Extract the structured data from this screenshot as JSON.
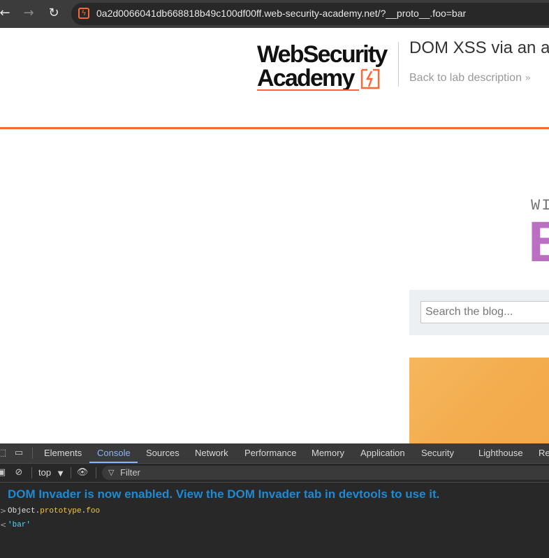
{
  "browser": {
    "back_icon": "arrow-left-icon",
    "forward_icon": "arrow-right-icon",
    "reload_icon": "reload-icon",
    "url": "0a2d0066041db668818b49c100df00ff.web-security-academy.net/?__proto__.foo=bar"
  },
  "page": {
    "logo_line1": "WebSecurity",
    "logo_line2": "Academy",
    "lab_title": "DOM XSS via an a",
    "back_link": "Back to lab description",
    "back_chevron": "»",
    "hero_small": "WI",
    "hero_big": "B",
    "search_placeholder": "Search the blog...",
    "colors": {
      "accent": "#ff6633",
      "hero": "#ba6fc2",
      "search_band": "#ecf0f2"
    }
  },
  "devtools": {
    "tabs": [
      {
        "label": "Elements"
      },
      {
        "label": "Console"
      },
      {
        "label": "Sources"
      },
      {
        "label": "Network"
      },
      {
        "label": "Performance"
      },
      {
        "label": "Memory"
      },
      {
        "label": "Application"
      },
      {
        "label": "Security"
      },
      {
        "label": "Lighthouse"
      },
      {
        "label": "Re"
      }
    ],
    "active_tab": "Console",
    "context": "top",
    "filter_label": "Filter",
    "console": {
      "banner": "DOM Invader is now enabled. View the DOM Invader tab in devtools to use it.",
      "input_object": "Object",
      "input_dot1": ".",
      "input_prop1": "prototype",
      "input_dot2": ".",
      "input_prop2": "foo",
      "output_value": "'bar'",
      "input_marker": ">",
      "output_marker": "<"
    },
    "colors": {
      "active_tab": "#8ab4f8",
      "banner": "#1f8ad2",
      "property": "#f2c94c",
      "string": "#5cd5fb"
    }
  }
}
